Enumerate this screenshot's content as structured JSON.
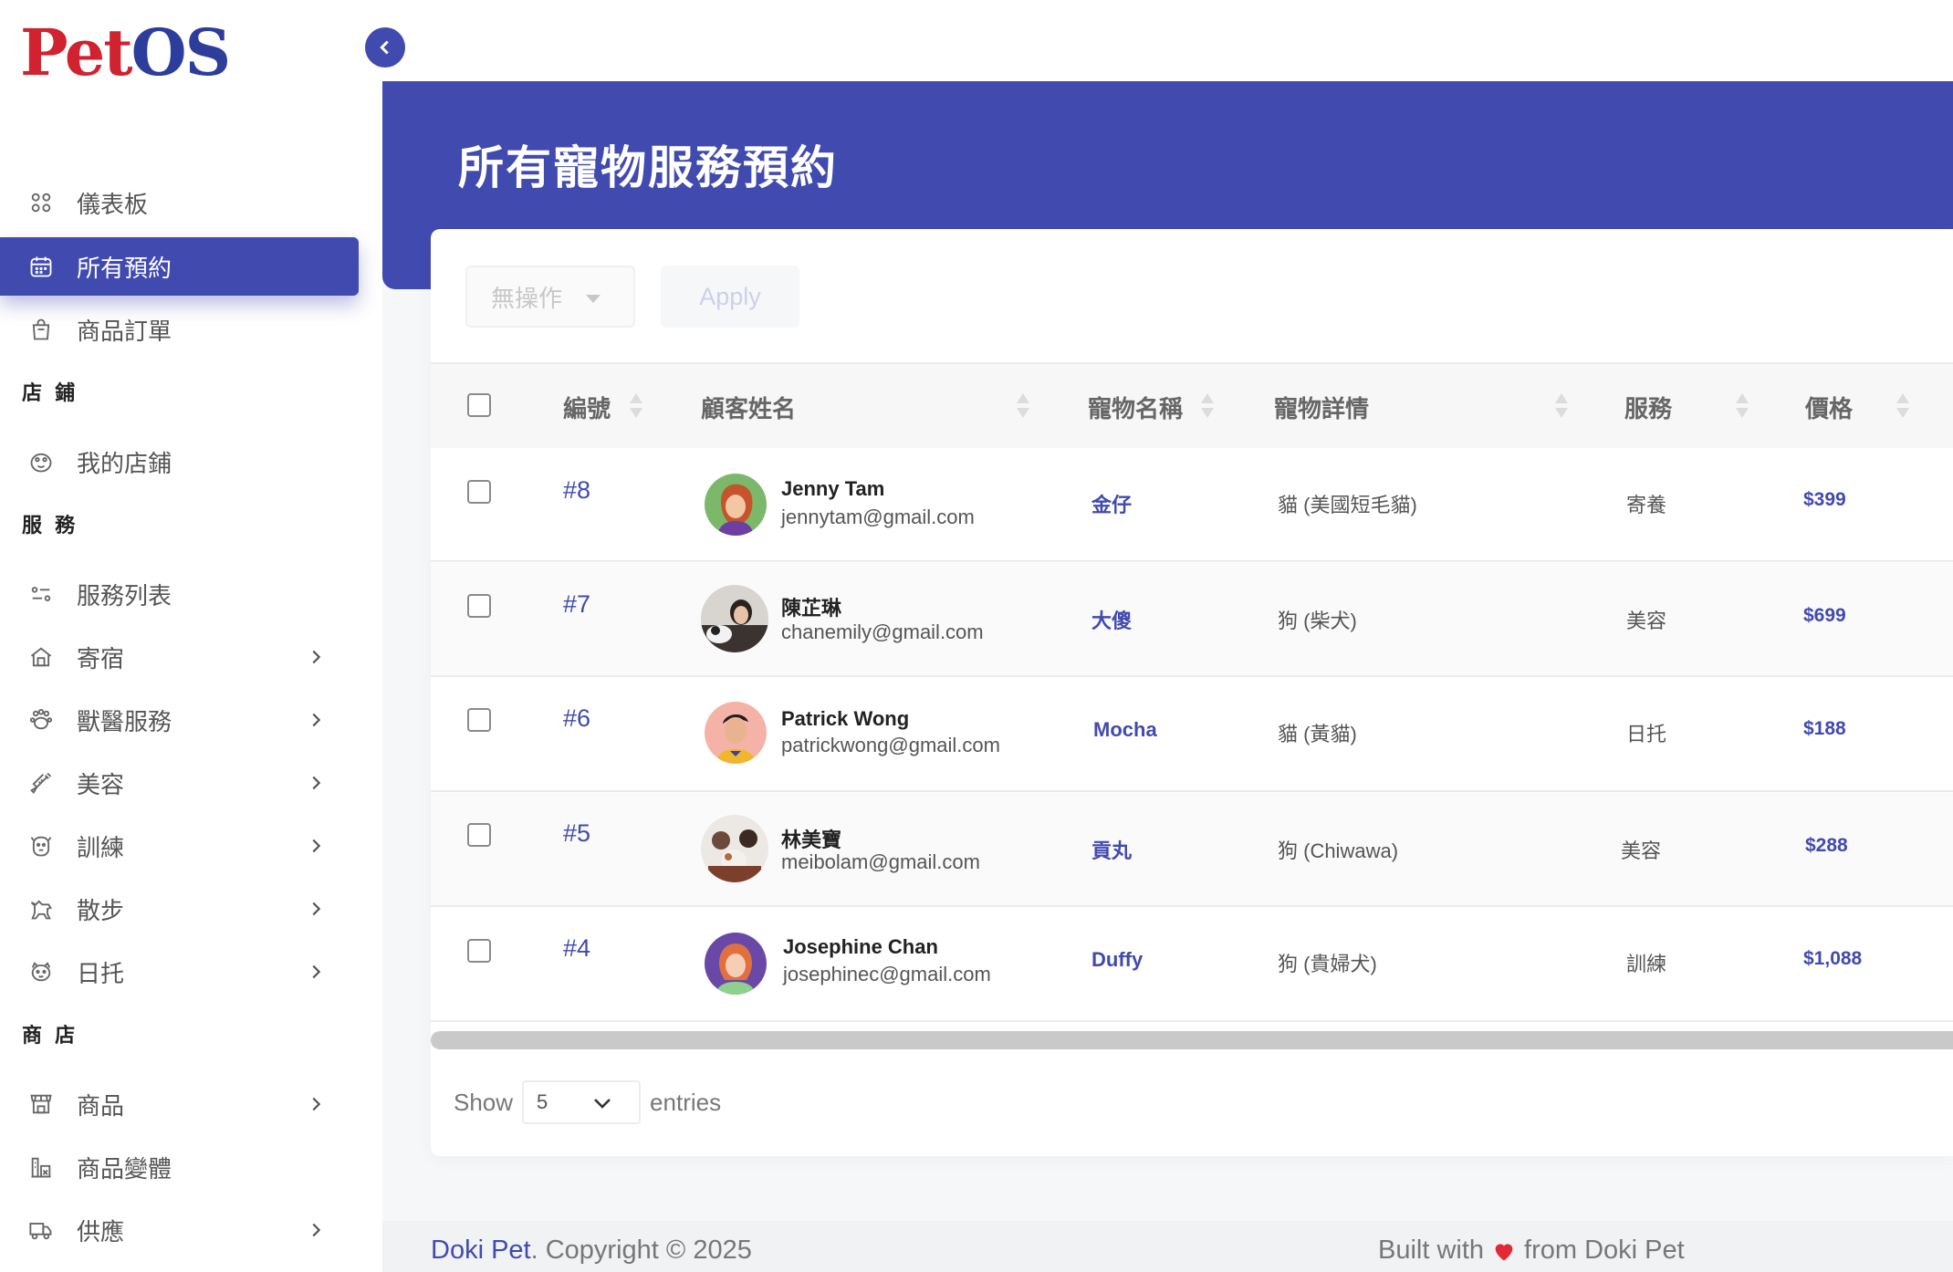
{
  "app": {
    "logo_pet": "Pet",
    "logo_os": "OS"
  },
  "sidebar": {
    "items": [
      {
        "label": "儀表板",
        "icon": "grid-icon"
      },
      {
        "label": "所有預約",
        "icon": "calendar-icon",
        "active": true
      },
      {
        "label": "商品訂單",
        "icon": "shopping-bag-icon"
      }
    ],
    "sections": [
      {
        "title": "店 鋪",
        "items": [
          {
            "label": "我的店鋪",
            "icon": "paw-shop-icon"
          }
        ]
      },
      {
        "title": "服 務",
        "items": [
          {
            "label": "服務列表",
            "icon": "sliders-icon"
          },
          {
            "label": "寄宿",
            "icon": "house-icon"
          },
          {
            "label": "獸醫服務",
            "icon": "paws-icon"
          },
          {
            "label": "美容",
            "icon": "syringe-icon"
          },
          {
            "label": "訓練",
            "icon": "dog-face-icon"
          },
          {
            "label": "散步",
            "icon": "running-dog-icon"
          },
          {
            "label": "日托",
            "icon": "dog-head-icon"
          }
        ]
      },
      {
        "title": "商 店",
        "items": [
          {
            "label": "商品",
            "icon": "storefront-icon"
          },
          {
            "label": "商品變體",
            "icon": "variants-icon"
          },
          {
            "label": "供應",
            "icon": "truck-icon"
          }
        ]
      }
    ]
  },
  "page": {
    "title": "所有寵物服務預約"
  },
  "toolbar": {
    "bulk_action": "無操作",
    "apply_label": "Apply"
  },
  "table": {
    "headers": {
      "id": "編號",
      "customer": "顧客姓名",
      "pet_name": "寵物名稱",
      "pet_detail": "寵物詳情",
      "service": "服務",
      "price": "價格"
    },
    "rows": [
      {
        "id": "#8",
        "name": "Jenny Tam",
        "email": "jennytam@gmail.com",
        "pet": "金仔",
        "detail": "貓 (美國短毛貓)",
        "service": "寄養",
        "price": "$399"
      },
      {
        "id": "#7",
        "name": "陳芷琳",
        "email": "chanemily@gmail.com",
        "pet": "大傻",
        "detail": "狗 (柴犬)",
        "service": "美容",
        "price": "$699"
      },
      {
        "id": "#6",
        "name": "Patrick Wong",
        "email": "patrickwong@gmail.com",
        "pet": "Mocha",
        "detail": "貓 (黃貓)",
        "service": "日托",
        "price": "$188"
      },
      {
        "id": "#5",
        "name": "林美寶",
        "email": "meibolam@gmail.com",
        "pet": "貢丸",
        "detail": "狗 (Chiwawa)",
        "service": "美容",
        "price": "$288"
      },
      {
        "id": "#4",
        "name": "Josephine Chan",
        "email": "josephinec@gmail.com",
        "pet": "Duffy",
        "detail": "狗 (貴婦犬)",
        "service": "訓練",
        "price": "$1,088"
      }
    ]
  },
  "pagination": {
    "show_label": "Show",
    "entries_value": "5",
    "entries_label": "entries"
  },
  "footer": {
    "brand": "Doki Pet",
    "copyright": ". Copyright © 2025",
    "built_with": "Built with",
    "from": "from Doki Pet"
  },
  "colors": {
    "primary": "#414aae",
    "logo_red": "#d0222f",
    "heart": "#e02b36"
  }
}
